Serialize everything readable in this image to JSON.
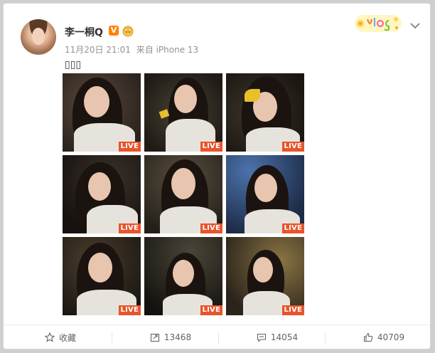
{
  "post": {
    "author": "李一桐Q",
    "verified_badge": "V",
    "date": "11月20日 21:01",
    "source": "来自 iPhone 13",
    "text": "▯▯▯"
  },
  "photos": [
    {
      "live": "LIVE",
      "bg": "#3a2f27",
      "accent": "#6b5b4c"
    },
    {
      "live": "LIVE",
      "bg": "#2f2a22",
      "accent": "#d4b239"
    },
    {
      "live": "LIVE",
      "bg": "#2c2721",
      "accent": "#e0b92b"
    },
    {
      "live": "LIVE",
      "bg": "#2a2420",
      "accent": "#4e3d33"
    },
    {
      "live": "LIVE",
      "bg": "#3a352c",
      "accent": "#7a6c55"
    },
    {
      "live": "LIVE",
      "bg": "#1f2a3d",
      "accent": "#3b5d8c"
    },
    {
      "live": "LIVE",
      "bg": "#2e2a22",
      "accent": "#6d5a3e"
    },
    {
      "live": "LIVE",
      "bg": "#26231f",
      "accent": "#4f4a3f"
    },
    {
      "live": "LIVE",
      "bg": "#2b2620",
      "accent": "#8f7a4e"
    }
  ],
  "actions": {
    "favorite_label": "收藏",
    "repost_count": "13468",
    "comment_count": "14054",
    "like_count": "40709"
  },
  "colors": {
    "accent_orange": "#ff8200",
    "live_badge": "#e8542b",
    "meta_gray": "#939393"
  }
}
